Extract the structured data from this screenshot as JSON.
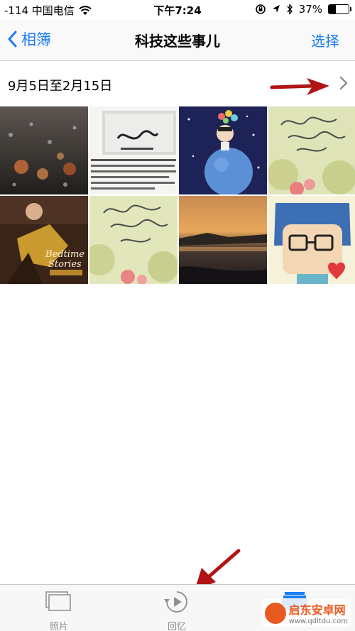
{
  "status_bar": {
    "carrier": "-114 中国电信",
    "time": "下午7:24",
    "battery": "37%",
    "battery_level": 0.37,
    "icons": [
      "wifi-icon",
      "rotation-lock-icon",
      "location-icon",
      "bluetooth-icon",
      "battery-icon"
    ]
  },
  "nav": {
    "back_label": "相簿",
    "title": "科技这些事儿",
    "select_label": "选择"
  },
  "section": {
    "date_range": "9月5日至2月15日"
  },
  "thumbnails": [
    {
      "name": "rainy-street-photo"
    },
    {
      "name": "book-cover-photo"
    },
    {
      "name": "cartoon-planet-photo"
    },
    {
      "name": "floral-artwork-photo"
    },
    {
      "name": "album-cover-photo"
    },
    {
      "name": "floral-artwork-photo-2"
    },
    {
      "name": "sunset-coast-photo"
    },
    {
      "name": "cartoon-face-photo"
    }
  ],
  "tabbar": {
    "photos_label": "照片",
    "memories_label": "回忆"
  },
  "accent_color": "#1a7cf5",
  "annotation_color": "#b01414",
  "watermark": {
    "text": "启东安卓网",
    "url": "www.qdltdu.com"
  }
}
